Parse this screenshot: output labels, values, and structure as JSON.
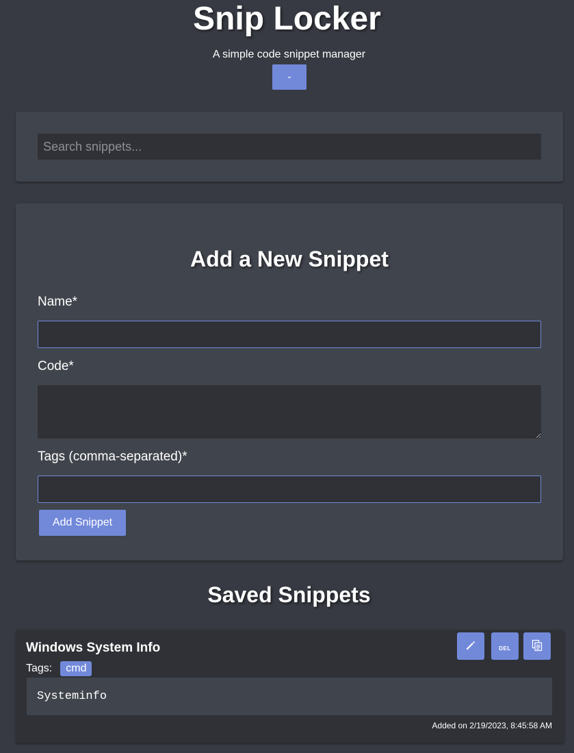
{
  "header": {
    "title": "Snip Locker",
    "subtitle": "A simple code snippet manager",
    "toggle_label": "-"
  },
  "search": {
    "placeholder": "Search snippets...",
    "value": ""
  },
  "form": {
    "title": "Add a New Snippet",
    "name_label": "Name*",
    "name_value": "",
    "code_label": "Code*",
    "code_value": "",
    "tags_label": "Tags (comma-separated)*",
    "tags_value": "",
    "submit_label": "Add Snippet"
  },
  "saved": {
    "title": "Saved Snippets",
    "snippets": [
      {
        "name": "Windows System Info",
        "tags_label": "Tags:",
        "tags": [
          "cmd"
        ],
        "code": "Systeminfo",
        "added": "Added on 2/19/2023, 8:45:58 AM",
        "edit_icon": "pencil-icon",
        "delete_label": "DEL",
        "copy_icon": "copy-icon"
      }
    ]
  },
  "colors": {
    "background": "#373a42",
    "card": "#40444c",
    "input": "#2f3136",
    "accent": "#7289da"
  }
}
